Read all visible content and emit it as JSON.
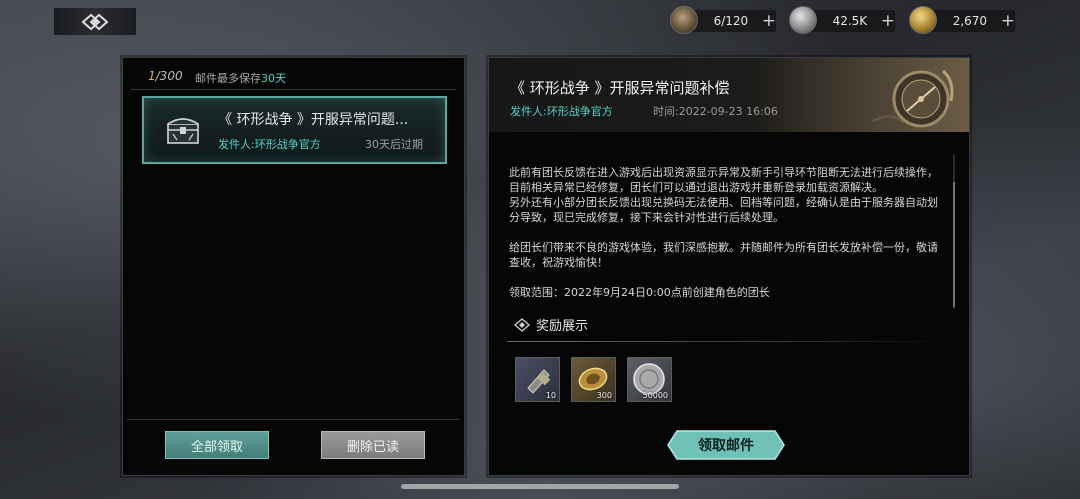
{
  "resources": [
    {
      "name": "stamina",
      "value": "6/120",
      "icon": "stamina-icon"
    },
    {
      "name": "silver",
      "value": "42.5K",
      "icon": "silver-coin-icon"
    },
    {
      "name": "gold",
      "value": "2,670",
      "icon": "gold-coin-icon"
    }
  ],
  "mailbox": {
    "count_current": "1",
    "count_max": "/300",
    "limit_prefix": "邮件最多保存",
    "limit_days": "30天",
    "item": {
      "title": "《 环形战争 》开服异常问题...",
      "sender": "发件人:环形战争官方",
      "expire": "30天后过期"
    },
    "collect_all_label": "全部领取",
    "delete_read_label": "删除已读"
  },
  "mail_detail": {
    "title": "《 环形战争 》开服异常问题补偿",
    "sender": "发件人:环形战争官方",
    "time": "时间:2022-09-23 16:06",
    "body": {
      "p1": "此前有团长反馈在进入游戏后出现资源显示异常及新手引导环节阻断无法进行后续操作，目前相关异常已经修复，团长们可以通过退出游戏并重新登录加载资源解决。",
      "p2": "另外还有小部分团长反馈出现兑换码无法使用、回档等问题，经确认是由于服务器自动划分导致，现已完成修复，接下来会针对性进行后续处理。",
      "p3": "给团长们带来不良的游戏体验，我们深感抱歉。并随邮件为所有团长发放补偿一份，敬请查收，祝游戏愉快！",
      "p4": "领取范围：2022年9月24日0:00点前创建角色的团长"
    },
    "reward_heading": "奖励展示",
    "rewards": [
      {
        "icon": "stamina-item-icon",
        "qty": "10"
      },
      {
        "icon": "gold-item-icon",
        "qty": "300"
      },
      {
        "icon": "silver-item-icon",
        "qty": "50000"
      }
    ],
    "claim_label": "领取邮件"
  },
  "colors": {
    "accent_teal": "#52d3c6",
    "count_gold": "#e1b94a",
    "panel_bg": "#060607"
  }
}
